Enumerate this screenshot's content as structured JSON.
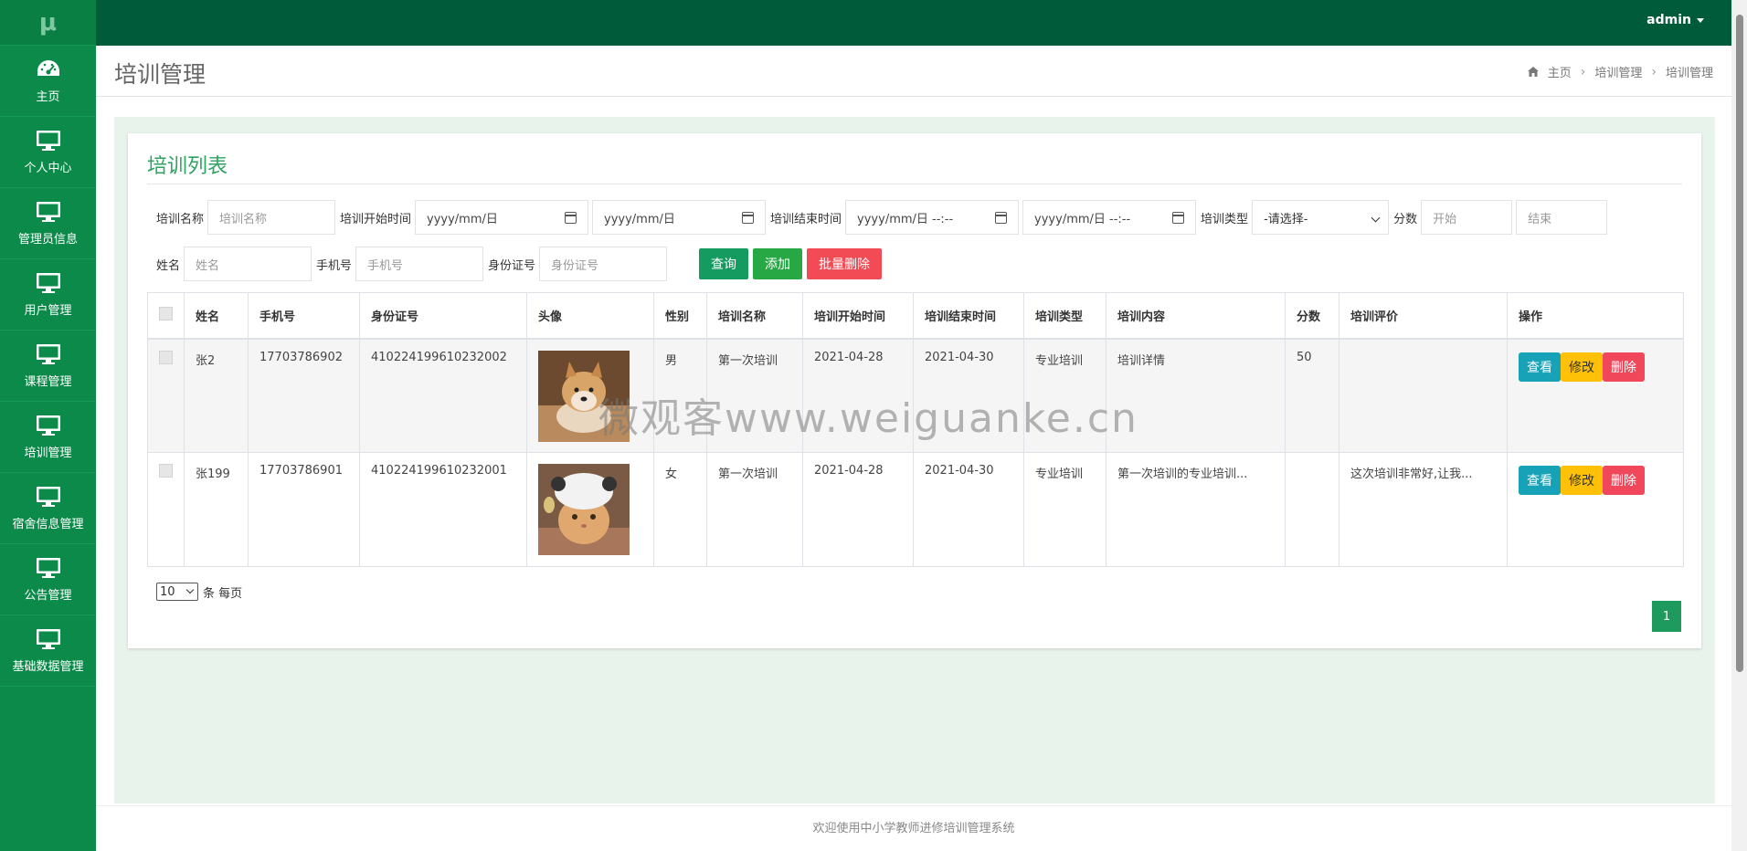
{
  "logo": "μ",
  "sidebar": {
    "items": [
      {
        "label": "主页",
        "icon": "dashboard-icon"
      },
      {
        "label": "个人中心",
        "icon": "monitor-icon"
      },
      {
        "label": "管理员信息",
        "icon": "monitor-icon"
      },
      {
        "label": "用户管理",
        "icon": "monitor-icon"
      },
      {
        "label": "课程管理",
        "icon": "monitor-icon"
      },
      {
        "label": "培训管理",
        "icon": "monitor-icon"
      },
      {
        "label": "宿舍信息管理",
        "icon": "monitor-icon"
      },
      {
        "label": "公告管理",
        "icon": "monitor-icon"
      },
      {
        "label": "基础数据管理",
        "icon": "monitor-icon"
      }
    ]
  },
  "topbar": {
    "user": "admin"
  },
  "header": {
    "title": "培训管理",
    "breadcrumb": [
      "主页",
      "培训管理",
      "培训管理"
    ]
  },
  "panel": {
    "title": "培训列表"
  },
  "search": {
    "train_name_label": "培训名称",
    "train_name_placeholder": "培训名称",
    "start_label": "培训开始时间",
    "start_from": "yyyy/mm/日",
    "start_to": "yyyy/mm/日",
    "end_label": "培训结束时间",
    "end_from": "yyyy/mm/日 --:--",
    "end_to": "yyyy/mm/日 --:--",
    "type_label": "培训类型",
    "type_selected": "-请选择-",
    "score_label": "分数",
    "score_from_placeholder": "开始",
    "score_to_placeholder": "结束",
    "name_label": "姓名",
    "name_placeholder": "姓名",
    "phone_label": "手机号",
    "phone_placeholder": "手机号",
    "id_label": "身份证号",
    "id_placeholder": "身份证号",
    "query_btn": "查询",
    "add_btn": "添加",
    "batch_delete_btn": "批量删除"
  },
  "table": {
    "headers": [
      "姓名",
      "手机号",
      "身份证号",
      "头像",
      "性别",
      "培训名称",
      "培训开始时间",
      "培训结束时间",
      "培训类型",
      "培训内容",
      "分数",
      "培训评价",
      "操作"
    ],
    "rows": [
      {
        "name": "张2",
        "phone": "17703786902",
        "id_no": "410224199610232002",
        "avatar": "shiba-dog",
        "gender": "男",
        "train_name": "第一次培训",
        "start": "2021-04-28",
        "end": "2021-04-30",
        "type": "专业培训",
        "content": "培训详情",
        "score": "50",
        "review": ""
      },
      {
        "name": "张199",
        "phone": "17703786901",
        "id_no": "410224199610232001",
        "avatar": "cat-hat",
        "gender": "女",
        "train_name": "第一次培训",
        "start": "2021-04-28",
        "end": "2021-04-30",
        "type": "专业培训",
        "content": "第一次培训的专业培训...",
        "score": "",
        "review": "这次培训非常好,让我..."
      }
    ],
    "op_view": "查看",
    "op_edit": "修改",
    "op_delete": "删除"
  },
  "pagination": {
    "page_size": "10",
    "page_size_suffix": "条 每页",
    "current_page": "1"
  },
  "footer": "欢迎使用中小学教师进修培训管理系统",
  "watermark": "微观客www.weiguanke.cn",
  "colors": {
    "sidebar": "#0b8a4a",
    "topbar": "#005b3b",
    "accent": "#2ea35f"
  }
}
